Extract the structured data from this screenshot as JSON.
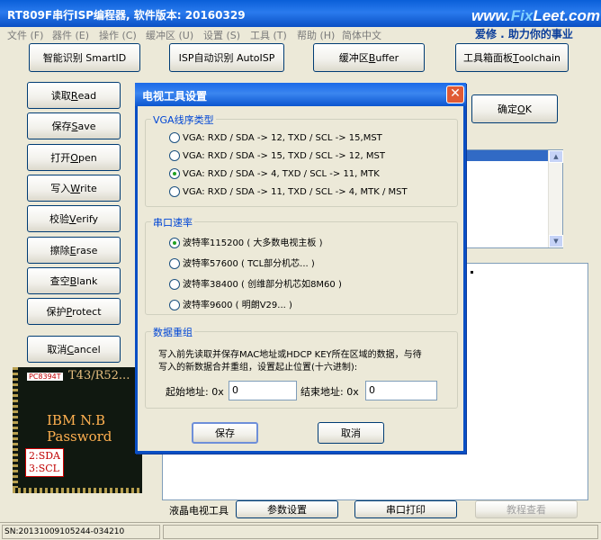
{
  "window": {
    "title": "RT809F串行ISP编程器, 软件版本: 20160329",
    "watermark_pre": "www.",
    "watermark_brand": "Fix",
    "watermark_post": "Leet.com",
    "slogan": "爱修 . 助力你的事业"
  },
  "menu": [
    "文件 (F)",
    "器件 (E)",
    "操作 (C)",
    "缓冲区 (U)",
    "设置 (S)",
    "工具 (T)",
    "帮助 (H)",
    "简体中文"
  ],
  "toolbar": {
    "smartid": "智能识别 SmartID",
    "isp_autoid": "ISP自动识别 AutoISP",
    "buffer_pre": "缓冲区 ",
    "buffer_key": "B",
    "buffer_post": "uffer",
    "toolpanel_pre": "工具箱面板 ",
    "toolpanel_key": "T",
    "toolpanel_post": "oolchain"
  },
  "side_buttons": [
    {
      "pre": "读取 ",
      "key": "R",
      "post": "ead"
    },
    {
      "pre": "保存 ",
      "key": "S",
      "post": "ave"
    },
    {
      "pre": "打开 ",
      "key": "O",
      "post": "pen"
    },
    {
      "pre": "写入 ",
      "key": "W",
      "post": "rite"
    },
    {
      "pre": "校验 ",
      "key": "V",
      "post": "erify"
    },
    {
      "pre": "擦除 ",
      "key": "E",
      "post": "rase"
    },
    {
      "pre": "查空 ",
      "key": "B",
      "post": "lank"
    },
    {
      "pre": "保护 ",
      "key": "P",
      "post": "rotect"
    },
    {
      "pre": "取消 ",
      "key": "C",
      "post": "ancel"
    }
  ],
  "confirm": {
    "pre": "确定 ",
    "key": "O",
    "post": "K"
  },
  "chip": {
    "label": "PC8394T",
    "title": "T43/R52...",
    "line1": "IBM N.B",
    "line2": "Password",
    "sda": "2:SDA",
    "scl": "3:SCL"
  },
  "bottom": {
    "lcd_tool": "液晶电视工具",
    "param_settings": "参数设置",
    "serial_print": "串口打印",
    "tutorial": "教程查看"
  },
  "status": {
    "sn": "SN:20131009105244-034210"
  },
  "dialog": {
    "title": "电视工具设置",
    "close_glyph": "✕",
    "vga_group": "VGA线序类型",
    "vga_options": [
      {
        "label": "VGA: RXD / SDA -> 12, TXD / SCL -> 15,MST",
        "selected": false
      },
      {
        "label": "VGA: RXD / SDA -> 15, TXD / SCL -> 12, MST",
        "selected": false
      },
      {
        "label": "VGA: RXD / SDA ->  4, TXD / SCL -> 11, MTK",
        "selected": true
      },
      {
        "label": "VGA: RXD / SDA -> 11, TXD / SCL ->  4, MTK / MST",
        "selected": false
      }
    ],
    "baud_group": "串口速率",
    "baud_options": [
      {
        "label": "波特率115200 ( 大多数电视主板 )",
        "selected": true
      },
      {
        "label": "波特率57600 ( TCL部分机芯... )",
        "selected": false
      },
      {
        "label": "波特率38400 ( 创维部分机芯如8M60 )",
        "selected": false
      },
      {
        "label": "波特率9600 ( 明朗V29... )",
        "selected": false
      }
    ],
    "merge_group": "数据重组",
    "merge_desc1": "写入前先读取并保存MAC地址或HDCP KEY所在区域的数据，与待",
    "merge_desc2": "写入的新数据合并重组，设置起止位置(十六进制):",
    "start_label": "起始地址: 0x",
    "start_value": "0",
    "end_label": "结束地址: 0x",
    "end_value": "0",
    "save": "保存",
    "cancel": "取消"
  }
}
